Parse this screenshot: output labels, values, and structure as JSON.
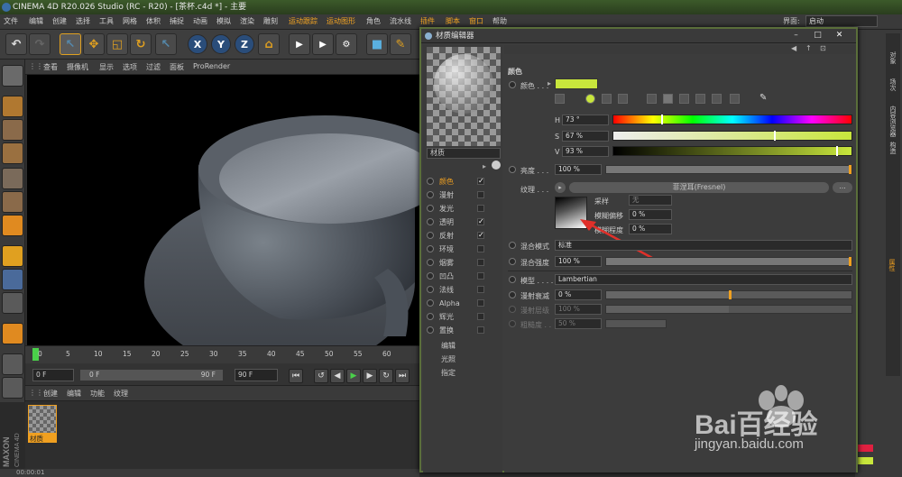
{
  "titlebar": {
    "text": "CINEMA 4D R20.026 Studio (RC - R20) - [茶杯.c4d *] - 主要"
  },
  "menubar": {
    "items": [
      "文件",
      "编辑",
      "创建",
      "选择",
      "工具",
      "网格",
      "体积",
      "捕捉",
      "动画",
      "模拟",
      "渲染",
      "雕刻",
      "运动跟踪",
      "运动图形",
      "角色",
      "流水线",
      "插件",
      "脚本",
      "窗口",
      "帮助"
    ],
    "highlighted": [
      "运动跟踪",
      "运动图形",
      "插件",
      "脚本",
      "窗口"
    ],
    "layout_label": "界面:",
    "layout_value": "启动"
  },
  "toolbar": {
    "axes": [
      "X",
      "Y",
      "Z"
    ]
  },
  "viewport_menu": {
    "items": [
      "查看",
      "摄像机",
      "显示",
      "选项",
      "过滤",
      "面板",
      "ProRender"
    ]
  },
  "timeline": {
    "ticks": [
      "0",
      "5",
      "10",
      "15",
      "20",
      "25",
      "30",
      "35",
      "40",
      "45",
      "50",
      "55",
      "60"
    ]
  },
  "transport": {
    "start": "0 F",
    "current": "0 F",
    "end_inner": "90 F",
    "end": "90 F"
  },
  "matmgr_menu": {
    "items": [
      "创建",
      "编辑",
      "功能",
      "纹理"
    ]
  },
  "material": {
    "name": "材质"
  },
  "maxon": {
    "line1": "MAXON",
    "line2": "CINEMA 4D"
  },
  "statusbar": {
    "text": "00:00:01"
  },
  "right_strip": {
    "tabs": [
      "对象",
      "场次",
      "内容浏览器",
      "构造"
    ],
    "attr_tab": "属性"
  },
  "dialog": {
    "title": "材质编辑器",
    "material_name": "材质",
    "channels": [
      {
        "label": "颜色",
        "checked": true,
        "active": true
      },
      {
        "label": "漫射",
        "checked": false
      },
      {
        "label": "发光",
        "checked": false
      },
      {
        "label": "透明",
        "checked": true
      },
      {
        "label": "反射",
        "checked": true
      },
      {
        "label": "环境",
        "checked": false
      },
      {
        "label": "烟雾",
        "checked": false
      },
      {
        "label": "凹凸",
        "checked": false
      },
      {
        "label": "法线",
        "checked": false
      },
      {
        "label": "Alpha",
        "checked": false
      },
      {
        "label": "辉光",
        "checked": false
      },
      {
        "label": "置换",
        "checked": false
      }
    ],
    "extra": [
      "编辑",
      "光照",
      "指定"
    ],
    "section": "颜色",
    "color_label": "颜色 . . .",
    "color_swatch": "#c8e63c",
    "hsv": {
      "h_label": "H",
      "h_value": "73 °",
      "h_fraction": 0.2,
      "s_label": "S",
      "s_value": "67 %",
      "s_fraction": 0.67,
      "v_label": "V",
      "v_value": "93 %",
      "v_fraction": 0.93
    },
    "brightness_label": "亮度 . . .",
    "brightness_value": "100 %",
    "texture_label": "纹理 . . .",
    "texture_name": "菲涅耳(Fresnel)",
    "texture_more": "...",
    "sampling_label": "采样",
    "sampling_value": "无",
    "blur_offset_label": "模糊偏移",
    "blur_offset_value": "0 %",
    "blur_scale_label": "模糊程度",
    "blur_scale_value": "0 %",
    "mix_mode_label": "混合模式",
    "mix_mode_value": "标准",
    "mix_strength_label": "混合强度",
    "mix_strength_value": "100 %",
    "model_label": "模型 . . . . .",
    "model_value": "Lambertian",
    "diffuse_falloff_label": "漫射衰减",
    "diffuse_falloff_value": "0 %",
    "diffuse_level_label": "漫射层级",
    "diffuse_level_value": "100 %",
    "roughness_label": "粗糙度 . .",
    "roughness_value": "50 %"
  },
  "watermark": {
    "brand": "Bai百经验",
    "url": "jingyan.baidu.com"
  },
  "colors": {
    "accent": "#f5a623",
    "hue_marker": "#ffffff",
    "arrow": "#e0302a",
    "panel_border": "#5a6e3a"
  }
}
